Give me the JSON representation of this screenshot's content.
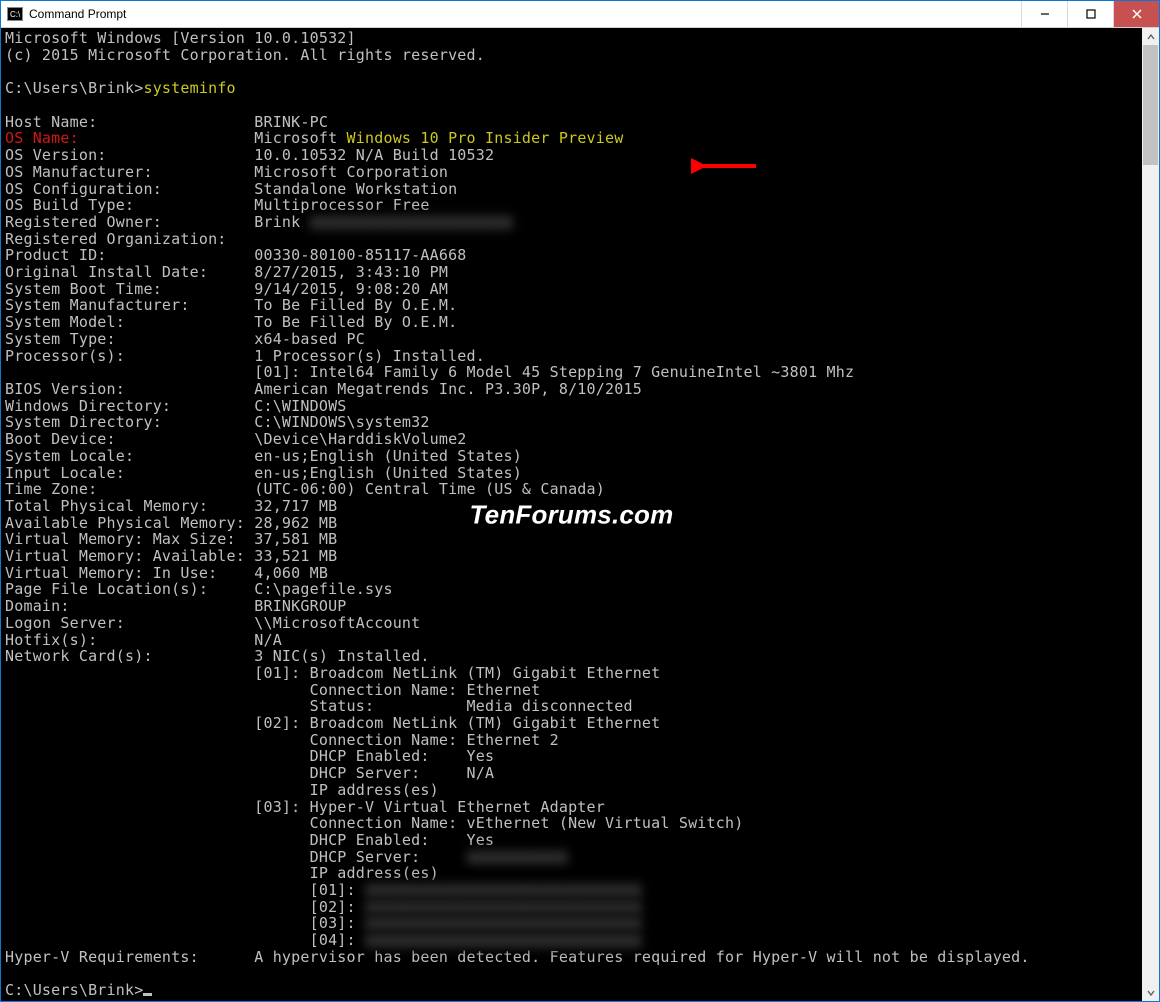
{
  "window": {
    "title": "Command Prompt"
  },
  "watermark": "TenForums.com",
  "header": {
    "line1": "Microsoft Windows [Version 10.0.10532]",
    "line2": "(c) 2015 Microsoft Corporation. All rights reserved."
  },
  "prompt1": {
    "path": "C:\\Users\\Brink>",
    "cmd": "systeminfo"
  },
  "prompt2": {
    "path": "C:\\Users\\Brink>",
    "cmd": ""
  },
  "rows": [
    {
      "label": "Host Name:",
      "value": "BRINK-PC"
    },
    {
      "label": "OS Name:",
      "value_prefix": "Microsoft ",
      "value_hl": "Windows 10 Pro Insider Preview",
      "hl_label": true
    },
    {
      "label": "OS Version:",
      "value": "10.0.10532 N/A Build 10532"
    },
    {
      "label": "OS Manufacturer:",
      "value": "Microsoft Corporation"
    },
    {
      "label": "OS Configuration:",
      "value": "Standalone Workstation"
    },
    {
      "label": "OS Build Type:",
      "value": "Multiprocessor Free"
    },
    {
      "label": "Registered Owner:",
      "value": "Brink",
      "blur_after": true
    },
    {
      "label": "Registered Organization:",
      "value": ""
    },
    {
      "label": "Product ID:",
      "value": "00330-80100-85117-AA668"
    },
    {
      "label": "Original Install Date:",
      "value": "8/27/2015, 3:43:10 PM"
    },
    {
      "label": "System Boot Time:",
      "value": "9/14/2015, 9:08:20 AM"
    },
    {
      "label": "System Manufacturer:",
      "value": "To Be Filled By O.E.M."
    },
    {
      "label": "System Model:",
      "value": "To Be Filled By O.E.M."
    },
    {
      "label": "System Type:",
      "value": "x64-based PC"
    },
    {
      "label": "Processor(s):",
      "value": "1 Processor(s) Installed."
    },
    {
      "label": "",
      "value": "[01]: Intel64 Family 6 Model 45 Stepping 7 GenuineIntel ~3801 Mhz"
    },
    {
      "label": "BIOS Version:",
      "value": "American Megatrends Inc. P3.30P, 8/10/2015"
    },
    {
      "label": "Windows Directory:",
      "value": "C:\\WINDOWS"
    },
    {
      "label": "System Directory:",
      "value": "C:\\WINDOWS\\system32"
    },
    {
      "label": "Boot Device:",
      "value": "\\Device\\HarddiskVolume2"
    },
    {
      "label": "System Locale:",
      "value": "en-us;English (United States)"
    },
    {
      "label": "Input Locale:",
      "value": "en-us;English (United States)"
    },
    {
      "label": "Time Zone:",
      "value": "(UTC-06:00) Central Time (US & Canada)"
    },
    {
      "label": "Total Physical Memory:",
      "value": "32,717 MB"
    },
    {
      "label": "Available Physical Memory:",
      "value": "28,962 MB"
    },
    {
      "label": "Virtual Memory: Max Size:",
      "value": "37,581 MB"
    },
    {
      "label": "Virtual Memory: Available:",
      "value": "33,521 MB"
    },
    {
      "label": "Virtual Memory: In Use:",
      "value": "4,060 MB"
    },
    {
      "label": "Page File Location(s):",
      "value": "C:\\pagefile.sys"
    },
    {
      "label": "Domain:",
      "value": "BRINKGROUP"
    },
    {
      "label": "Logon Server:",
      "value": "\\\\MicrosoftAccount"
    },
    {
      "label": "Hotfix(s):",
      "value": "N/A"
    },
    {
      "label": "Network Card(s):",
      "value": "3 NIC(s) Installed."
    }
  ],
  "nic": [
    "[01]: Broadcom NetLink (TM) Gigabit Ethernet",
    "      Connection Name: Ethernet",
    "      Status:          Media disconnected",
    "[02]: Broadcom NetLink (TM) Gigabit Ethernet",
    "      Connection Name: Ethernet 2",
    "      DHCP Enabled:    Yes",
    "      DHCP Server:     N/A",
    "      IP address(es)",
    "[03]: Hyper-V Virtual Ethernet Adapter",
    "      Connection Name: vEthernet (New Virtual Switch)",
    "      DHCP Enabled:    Yes"
  ],
  "nic_dhcp_server": "      DHCP Server:     ",
  "nic_ip_hdr": "      IP address(es)",
  "nic_ip_entries": [
    "      [01]:",
    "      [02]:",
    "      [03]:",
    "      [04]:"
  ],
  "footer": {
    "label": "Hyper-V Requirements:",
    "value": "A hypervisor has been detected. Features required for Hyper-V will not be displayed."
  }
}
